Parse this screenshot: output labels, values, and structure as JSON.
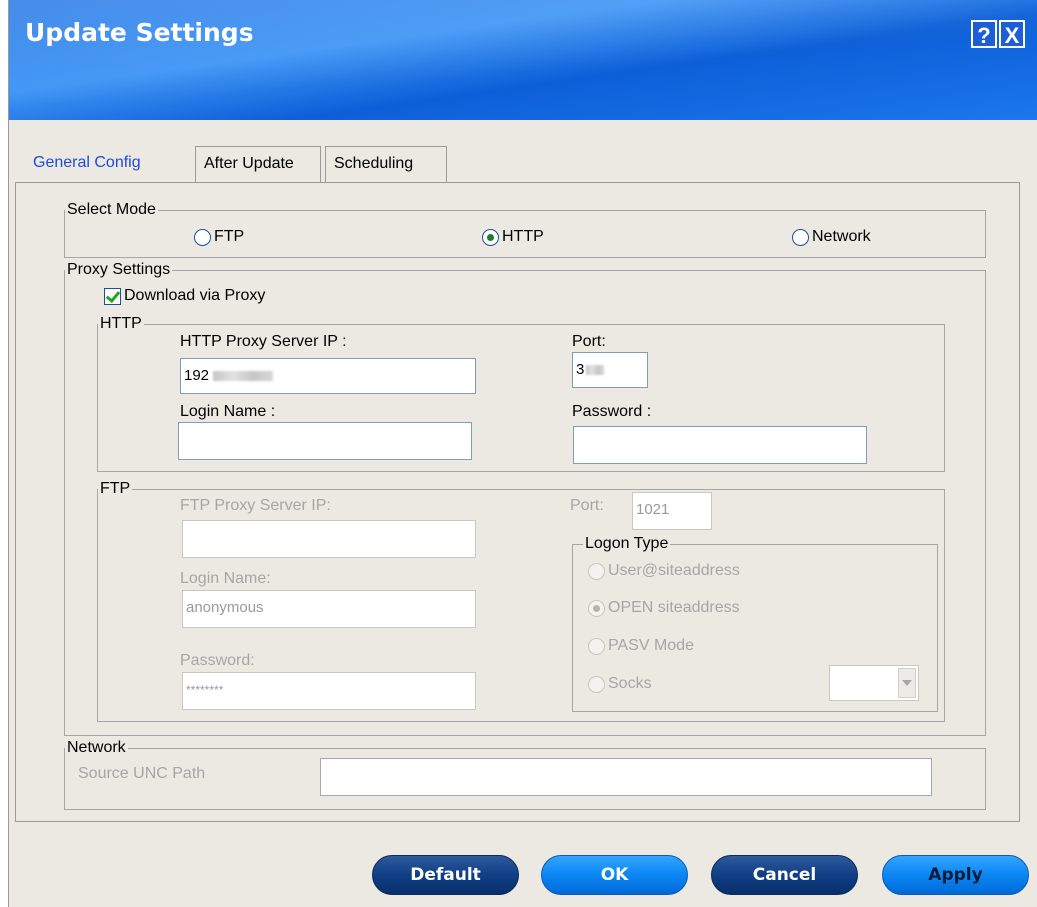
{
  "window": {
    "title": "Update Settings",
    "help_label": "?",
    "close_label": "X"
  },
  "tabs": [
    {
      "label": "General Config",
      "active": true
    },
    {
      "label": "After Update",
      "active": false
    },
    {
      "label": "Scheduling",
      "active": false
    }
  ],
  "select_mode": {
    "legend": "Select Mode",
    "options": [
      {
        "label": "FTP",
        "selected": false
      },
      {
        "label": "HTTP",
        "selected": true
      },
      {
        "label": "Network",
        "selected": false
      }
    ]
  },
  "proxy": {
    "legend": "Proxy Settings",
    "download_via_proxy": {
      "label": "Download via Proxy",
      "checked": true
    },
    "http": {
      "legend": "HTTP",
      "server_label": "HTTP Proxy Server IP :",
      "server_value": "192",
      "port_label": "Port:",
      "port_value": "3",
      "login_label": "Login Name :",
      "login_value": "",
      "password_label": "Password :",
      "password_value": ""
    },
    "ftp": {
      "legend": "FTP",
      "server_label": "FTP Proxy Server IP:",
      "server_value": "",
      "port_label": "Port:",
      "port_value": "1021",
      "login_label": "Login Name:",
      "login_value": "anonymous",
      "password_label": "Password:",
      "password_value": "********",
      "logon_type": {
        "legend": "Logon Type",
        "options": [
          {
            "label": "User@siteaddress",
            "selected": false
          },
          {
            "label": "OPEN siteaddress",
            "selected": true
          },
          {
            "label": "PASV Mode",
            "selected": false
          },
          {
            "label": "Socks",
            "selected": false
          }
        ],
        "socks_select_value": ""
      }
    }
  },
  "network": {
    "legend": "Network",
    "unc_label": "Source UNC Path",
    "unc_value": ""
  },
  "buttons": {
    "default": "Default",
    "ok": "OK",
    "cancel": "Cancel",
    "apply": "Apply"
  },
  "colors": {
    "title_bar": "#1f74e6",
    "active_tab_text": "#1f4bd7",
    "dark_button": "#0f3f86",
    "light_button": "#0b86f3",
    "dialog_bg": "#ebe9e2"
  }
}
